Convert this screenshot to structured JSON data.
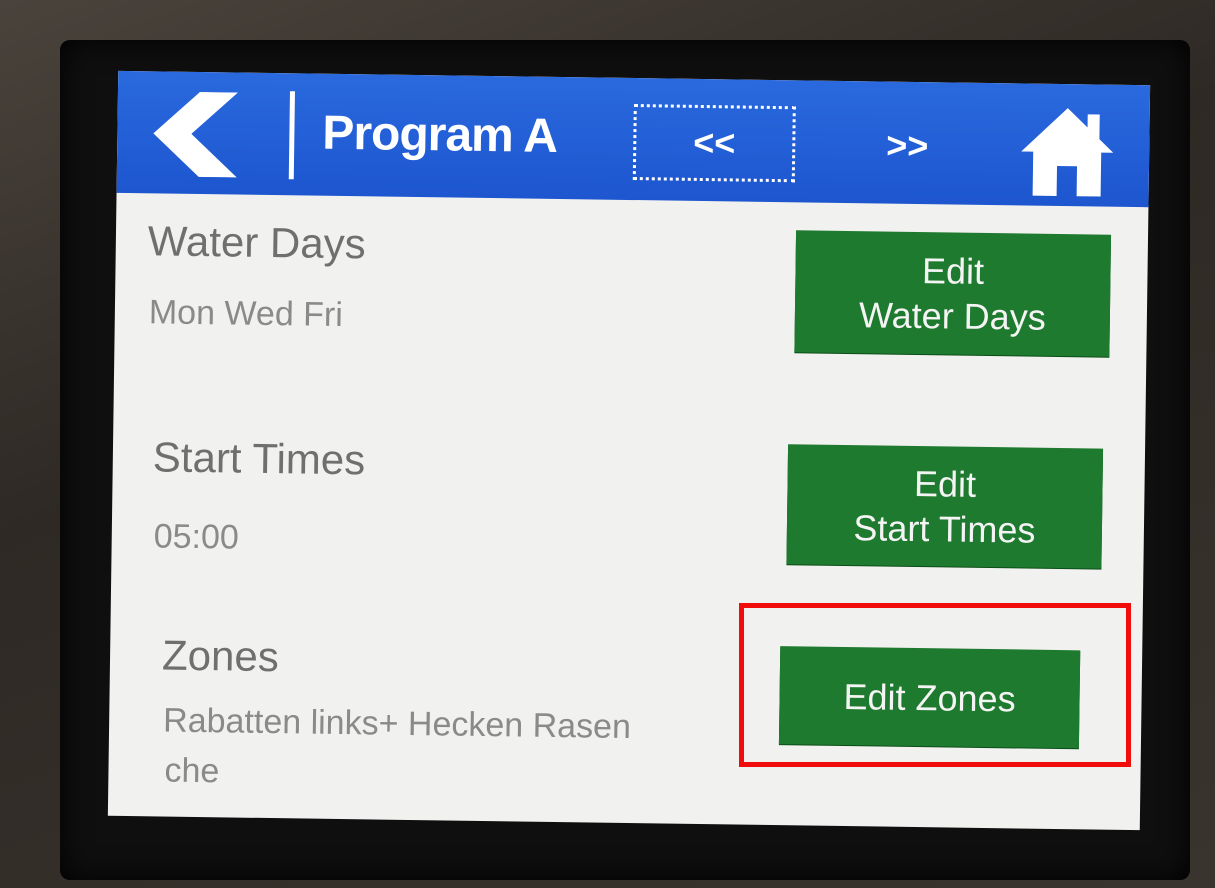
{
  "header": {
    "title": "Program A",
    "prev_label": "<<",
    "next_label": ">>"
  },
  "rows": {
    "water_days": {
      "label": "Water Days",
      "value": "Mon Wed Fri",
      "button_line1": "Edit",
      "button_line2": "Water Days"
    },
    "start_times": {
      "label": "Start Times",
      "value": "05:00",
      "button_line1": "Edit",
      "button_line2": "Start Times"
    },
    "zones": {
      "label": "Zones",
      "value_line1": "Rabatten links+ Hecken Rasen",
      "value_line2": "che",
      "button_label": "Edit Zones"
    }
  },
  "colors": {
    "header_blue": "#1d56cf",
    "button_green": "#1e7a2e",
    "highlight_red": "#f20d0d",
    "screen_bg": "#f1f1ef"
  },
  "icons": {
    "back": "back-arrow-icon",
    "home": "home-icon"
  }
}
